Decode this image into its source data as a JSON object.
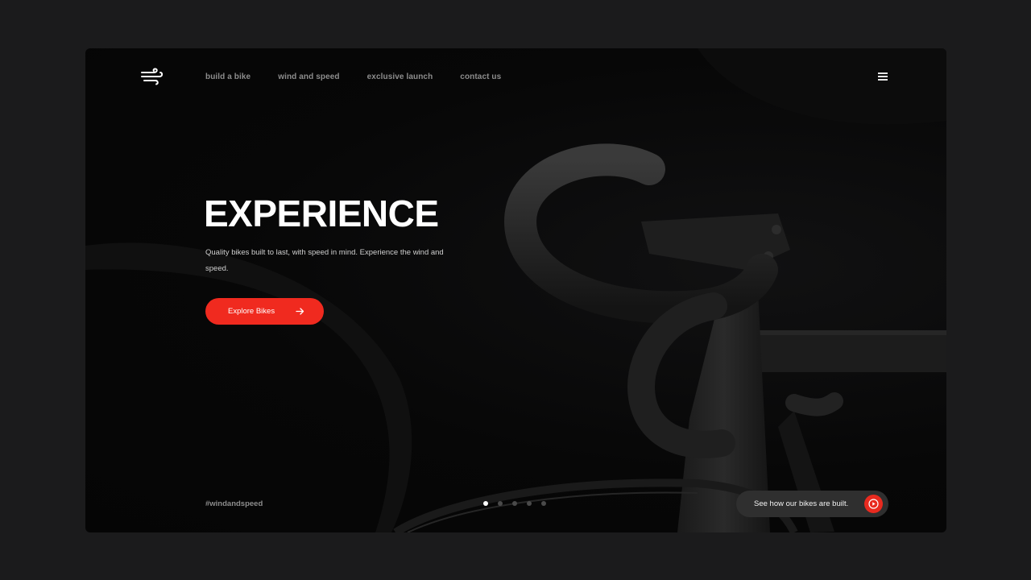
{
  "nav": {
    "logo": "wind-logo-icon",
    "links": [
      "build a bike",
      "wind and speed",
      "exclusive launch",
      "contact us"
    ],
    "menu_icon": "hamburger-menu-icon"
  },
  "hero": {
    "title": "EXPERIENCE",
    "description": "Quality bikes built to last, with speed in mind. Experience the wind and speed.",
    "cta_label": "Explore Bikes",
    "cta_icon": "arrow-right-icon"
  },
  "footer": {
    "hashtag": "#windandspeed",
    "slides": {
      "count": 5,
      "active_index": 0
    },
    "video_label": "See how our bikes are built.",
    "video_icon": "play-icon"
  },
  "colors": {
    "accent": "#f02a1f",
    "page_background": "#1b1b1c",
    "hero_background": "#070707",
    "nav_text": "#8d8d8d"
  }
}
